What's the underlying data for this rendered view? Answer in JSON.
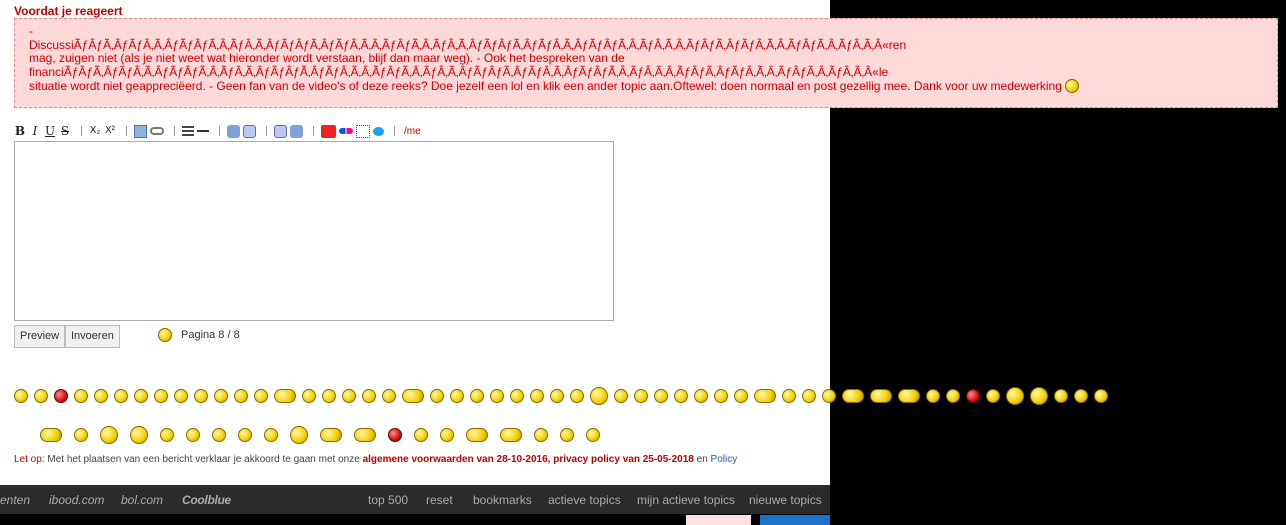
{
  "rules": {
    "title": "Voordat je reageert",
    "line1": "-",
    "line2": "DiscussiÃƒÂƒÃ‚ÂƒÃƒÂ‚Ã‚ÂƒÃƒÂƒÃ‚Â‚ÃƒÂ‚Ã‚ÂƒÃƒÂƒÃ‚ÂƒÃƒÂ‚Ã‚Â‚ÃƒÂƒÃ‚Â‚ÃƒÂ‚Ã‚ÂƒÃƒÂƒÃ‚ÂƒÃƒÂ‚Ã‚ÂƒÃƒÂƒÃ‚Â‚ÃƒÂ‚Ã‚Â‚ÃƒÂƒÃ‚ÂƒÃƒÂ‚Ã‚Â‚ÃƒÂƒÃ‚Â‚ÃƒÂ‚Ã‚Â«ren",
    "line3": "mag, zuigen niet (als je niet weet wat hieronder wordt verstaan, blijf dan maar weg). - Ook het bespreken van de",
    "line4": "financiÃƒÂƒÃ‚ÂƒÃƒÂ‚Ã‚ÂƒÃƒÂƒÃ‚Â‚ÃƒÂ‚Ã‚ÂƒÃƒÂƒÃ‚ÂƒÃƒÂ‚Ã‚Â‚ÃƒÂƒÃ‚Â‚ÃƒÂ‚Ã‚ÂƒÃƒÂƒÃ‚ÂƒÃƒÂ‚Ã‚ÂƒÃƒÂƒÃ‚Â‚ÃƒÂ‚Ã‚Â‚ÃƒÂƒÃ‚ÂƒÃƒÂ‚Ã‚Â‚ÃƒÂƒÃ‚Â‚ÃƒÂ‚Ã‚Â«le",
    "line5": "situatie wordt niet geappreciëerd. - Geen fan van de video's of deze reeks? Doe jezelf een lol en klik een ander topic aan.Oftewel: doen normaal en post gezellig mee. Dank voor uw medewerking"
  },
  "toolbar": {
    "bold": "B",
    "italic": "I",
    "underline": "U",
    "strike": "S",
    "subscript": "X₂",
    "superscript": "X²",
    "me": "/me"
  },
  "editor": {
    "value": ""
  },
  "buttons": {
    "preview": "Preview",
    "submit": "Invoeren"
  },
  "pagination": {
    "label": "Pagina 8 / 8"
  },
  "legal": {
    "prefix": "Let op:",
    "text": " Met het plaatsen van een bericht verklaar je akkoord te gaan met onze ",
    "terms": "algemene voorwaarden van 28-10-2016",
    "comma": ", ",
    "privacy": "privacy policy van 25-05-2018",
    "and": " en ",
    "policy": "Policy"
  },
  "footer": {
    "left_cut": "enten",
    "ibood": "ibood.com",
    "bol": "bol.com",
    "coolblue": "Coolblue",
    "top500": "top 500",
    "reset": "reset",
    "bookmarks": "bookmarks",
    "active_topics": "actieve topics",
    "my_active_topics": "mijn actieve topics",
    "new_topics": "nieuwe topics"
  },
  "colors": {
    "rules_bg": "#ffd9d9",
    "rules_text": "#d00000",
    "footer_bg": "#2b2b2b",
    "smiley_yellow": "#f2d000"
  }
}
